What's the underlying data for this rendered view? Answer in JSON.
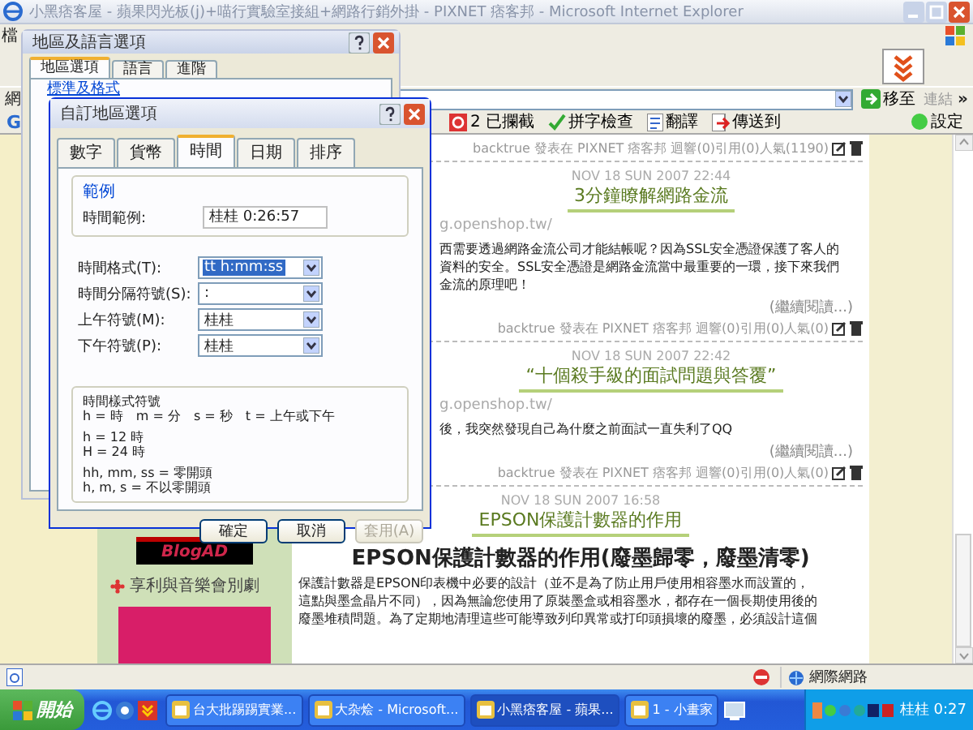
{
  "browser": {
    "title": "小黑痞客屋 - 蘋果閃光板(j)+喵行實驗室接組+網路行銷外掛 - PIXNET 痞客邦 - Microsoft Internet Explorer",
    "menu": [
      "檔"
    ],
    "address_label": "網",
    "go_button": "移至",
    "links": "連結",
    "chevron": "»",
    "google": {
      "logo": "G",
      "blocked": "2 已攔截",
      "spell": "拼字檢查",
      "translate": "翻譯",
      "send": "傳送到",
      "settings": "設定"
    }
  },
  "sidebar": {
    "banner": "BlogAD",
    "ad_title": "享利與音樂會別劇"
  },
  "posts": [
    {
      "meta": "backtrue 發表在 PIXNET 痞客邦 迴響(0)引用(0)人氣(1190)"
    },
    {
      "date": "NOV 18 SUN 2007 22:44",
      "title": "3分鐘瞭解網路金流",
      "url": "g.openshop.tw/",
      "body": [
        "西需要透過網路金流公司才能結帳呢？因為SSL安全憑證保護了客人的",
        "資料的安全。SSL安全憑證是網路金流當中最重要的一環，接下來我們",
        "金流的原理吧！"
      ],
      "more": "(繼續閱讀...)",
      "meta": "backtrue 發表在 PIXNET 痞客邦 迴響(0)引用(0)人氣(0)"
    },
    {
      "date": "NOV 18 SUN 2007 22:42",
      "title": "“十個殺手級的面試問題與答覆”",
      "url": "g.openshop.tw/",
      "body": [
        "後，我突然發現自己為什麼之前面試一直失利了QQ"
      ],
      "more": "(繼續閱讀...)",
      "meta": "backtrue 發表在 PIXNET 痞客邦 迴響(0)引用(0)人氣(0)"
    },
    {
      "date": "NOV 18 SUN 2007 16:58",
      "title": "EPSON保護計數器的作用",
      "heading": "EPSON保護計數器的作用(廢墨歸零，廢墨清零)",
      "body": [
        "保護計數器是EPSON印表機中必要的設計（並不是為了防止用戶使用相容墨水而設置的，",
        "這點與墨盒晶片不同），因為無論您使用了原裝墨盒或相容墨水，都存在一個長期使用後的",
        "廢墨堆積問題。為了定期地清理這些可能導致列印異常或打印頭損壞的廢墨，必須設計這個"
      ]
    }
  ],
  "status_bar": {
    "zone": "網際網路"
  },
  "regional_dialog": {
    "title": "地區及語言選項",
    "tabs": [
      {
        "label": "地區選項",
        "selected": true
      },
      {
        "label": "語言",
        "selected": false
      },
      {
        "label": "進階",
        "selected": false
      }
    ],
    "group": "標準及格式"
  },
  "custom_dialog": {
    "title": "自訂地區選項",
    "tabs": [
      {
        "label": "數字",
        "selected": false
      },
      {
        "label": "貨幣",
        "selected": false
      },
      {
        "label": "時間",
        "selected": true
      },
      {
        "label": "日期",
        "selected": false
      },
      {
        "label": "排序",
        "selected": false
      }
    ],
    "sample_group": "範例",
    "sample_label": "時間範例:",
    "sample_value": "桂桂 0:26:57",
    "fields": [
      {
        "label": "時間格式(T):",
        "value": "tt h:mm:ss",
        "highlighted": true
      },
      {
        "label": "時間分隔符號(S):",
        "value": ":",
        "highlighted": false
      },
      {
        "label": "上午符號(M):",
        "value": "桂桂",
        "highlighted": false
      },
      {
        "label": "下午符號(P):",
        "value": "桂桂",
        "highlighted": false
      }
    ],
    "legend": [
      [
        "時間樣式符號",
        "h = 時　m = 分　s = 秒　t = 上午或下午"
      ],
      [
        "h = 12 時",
        "H = 24 時"
      ],
      [
        "hh, mm, ss = 零開頭",
        "h, m, s = 不以零開頭"
      ]
    ],
    "buttons": [
      {
        "label": "確定",
        "disabled": false
      },
      {
        "label": "取消",
        "disabled": false
      },
      {
        "label": "套用(A)",
        "disabled": true
      }
    ]
  },
  "taskbar": {
    "start": "開始",
    "tasks": [
      {
        "label": "台大批踢踢實業...",
        "selected": false
      },
      {
        "label": "大杂烩 - Microsoft...",
        "selected": false
      },
      {
        "label": "小黑痞客屋 - 蘋果...",
        "selected": true
      },
      {
        "label": "1 - 小畫家",
        "selected": false
      }
    ],
    "clock": "桂桂 0:27"
  }
}
